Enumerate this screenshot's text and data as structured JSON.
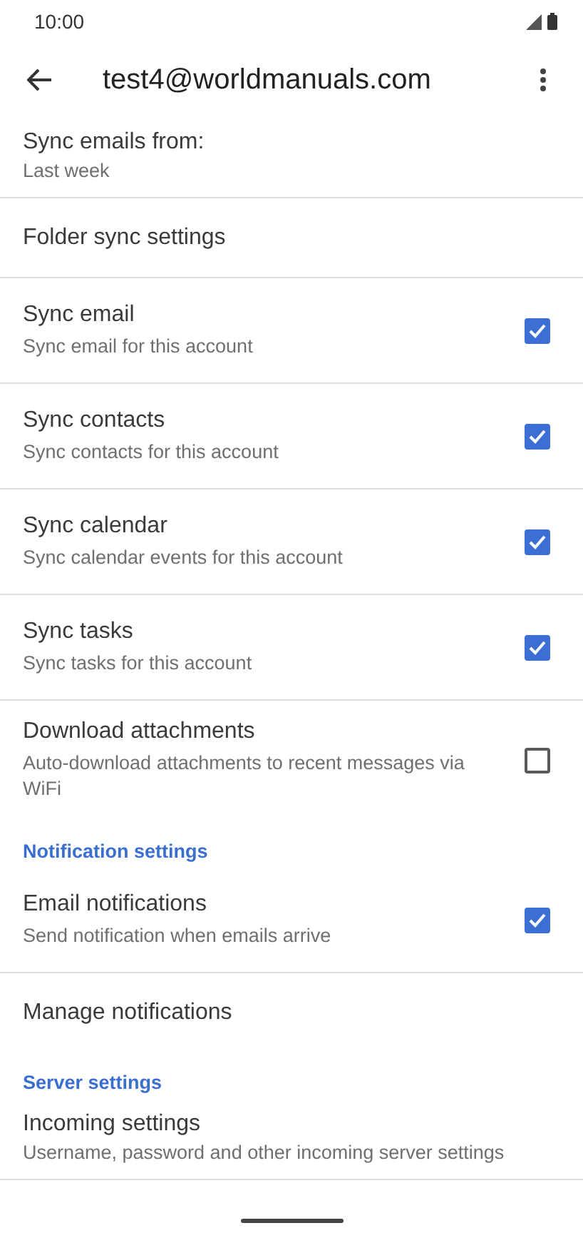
{
  "status_bar": {
    "time": "10:00"
  },
  "toolbar": {
    "title": "test4@worldmanuals.com"
  },
  "settings": [
    {
      "kind": "setting",
      "title": "Sync emails from:",
      "subtitle": "Last week"
    },
    {
      "kind": "setting",
      "title": "Folder sync settings"
    },
    {
      "kind": "checkbox",
      "title": "Sync email",
      "subtitle": "Sync email for this account",
      "checked": true
    },
    {
      "kind": "checkbox",
      "title": "Sync contacts",
      "subtitle": "Sync contacts for this account",
      "checked": true
    },
    {
      "kind": "checkbox",
      "title": "Sync calendar",
      "subtitle": "Sync calendar events for this account",
      "checked": true
    },
    {
      "kind": "checkbox",
      "title": "Sync tasks",
      "subtitle": "Sync tasks for this account",
      "checked": true
    },
    {
      "kind": "checkbox",
      "title": "Download attachments",
      "subtitle": "Auto-download attachments to recent messages via WiFi",
      "checked": false
    },
    {
      "kind": "header",
      "title": "Notification settings"
    },
    {
      "kind": "checkbox",
      "title": "Email notifications",
      "subtitle": "Send notification when emails arrive",
      "checked": true
    },
    {
      "kind": "setting",
      "title": "Manage notifications"
    },
    {
      "kind": "header",
      "title": "Server settings"
    },
    {
      "kind": "setting",
      "title": "Incoming settings",
      "subtitle": "Username, password and other incoming server settings"
    }
  ]
}
